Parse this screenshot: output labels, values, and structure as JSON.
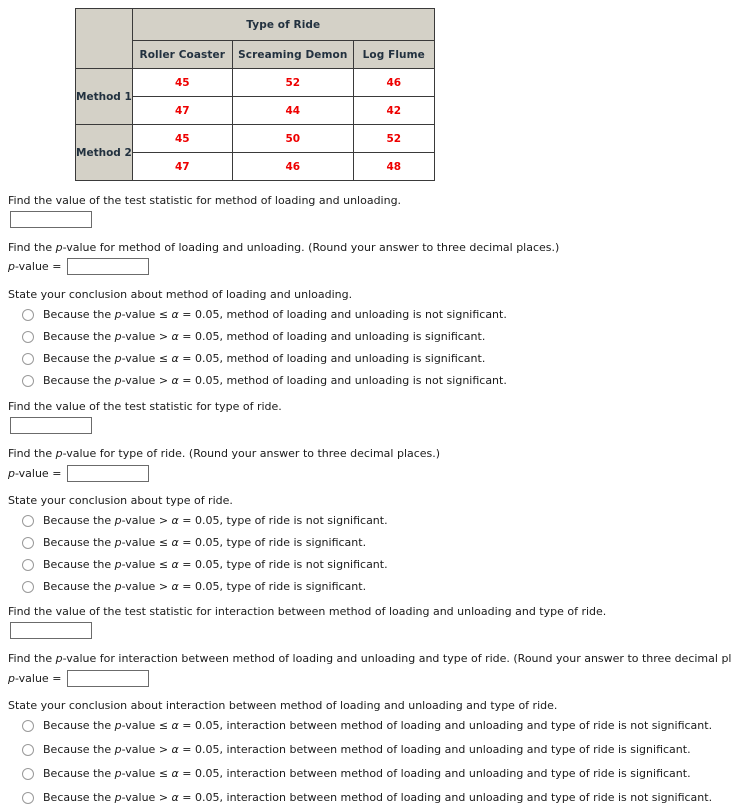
{
  "table": {
    "corner_label": "",
    "group_header": "Type of Ride",
    "columns": [
      "Roller Coaster",
      "Screaming Demon",
      "Log Flume"
    ],
    "row_groups": [
      {
        "label": "Method 1",
        "rows": [
          [
            "45",
            "52",
            "46"
          ],
          [
            "47",
            "44",
            "42"
          ]
        ]
      },
      {
        "label": "Method 2",
        "rows": [
          [
            "45",
            "50",
            "52"
          ],
          [
            "47",
            "46",
            "48"
          ]
        ]
      }
    ],
    "value_color": "#ee0000",
    "header_bg": "#d4d1c7"
  },
  "sections": [
    {
      "statistic_prompt": "Find the value of the test statistic for method of loading and unloading.",
      "statistic_value": "",
      "statistic_placeholder": "",
      "pvalue_prompt_a": "Find the ",
      "pvalue_prompt_b": "-value for method of loading and unloading. (Round your answer to three decimal places.)",
      "pvalue_label_b": "-value =",
      "pvalue_value": "",
      "conclusion_prompt": "State your conclusion about method of loading and unloading.",
      "options": [
        {
          "pre": "Because the ",
          "mid": "-value ≤ ",
          "post": " = 0.05, method of loading and unloading is not significant."
        },
        {
          "pre": "Because the ",
          "mid": "-value > ",
          "post": " = 0.05, method of loading and unloading is significant."
        },
        {
          "pre": "Because the ",
          "mid": "-value ≤ ",
          "post": " = 0.05, method of loading and unloading is significant."
        },
        {
          "pre": "Because the ",
          "mid": "-value > ",
          "post": " = 0.05, method of loading and unloading is not significant."
        }
      ]
    },
    {
      "statistic_prompt": "Find the value of the test statistic for type of ride.",
      "statistic_value": "",
      "statistic_placeholder": "",
      "pvalue_prompt_a": "Find the ",
      "pvalue_prompt_b": "-value for type of ride. (Round your answer to three decimal places.)",
      "pvalue_label_b": "-value =",
      "pvalue_value": "",
      "conclusion_prompt": "State your conclusion about type of ride.",
      "options": [
        {
          "pre": "Because the ",
          "mid": "-value > ",
          "post": " = 0.05, type of ride is not significant."
        },
        {
          "pre": "Because the ",
          "mid": "-value ≤ ",
          "post": " = 0.05, type of ride is significant."
        },
        {
          "pre": "Because the ",
          "mid": "-value ≤ ",
          "post": " = 0.05, type of ride is not significant."
        },
        {
          "pre": "Because the ",
          "mid": "-value > ",
          "post": " = 0.05, type of ride is significant."
        }
      ]
    },
    {
      "statistic_prompt": "Find the value of the test statistic for interaction between method of loading and unloading and type of ride.",
      "statistic_value": "",
      "statistic_placeholder": "",
      "pvalue_prompt_a": "Find the ",
      "pvalue_prompt_b": "-value for interaction between method of loading and unloading and type of ride. (Round your answer to three decimal places.)",
      "pvalue_label_b": "-value =",
      "pvalue_value": "",
      "conclusion_prompt": "State your conclusion about interaction between method of loading and unloading and type of ride.",
      "options": [
        {
          "pre": "Because the ",
          "mid": "-value ≤ ",
          "post": " = 0.05, interaction between method of loading and unloading and type of ride is not significant."
        },
        {
          "pre": "Because the ",
          "mid": "-value > ",
          "post": " = 0.05, interaction between method of loading and unloading and type of ride is significant."
        },
        {
          "pre": "Because the ",
          "mid": "-value ≤ ",
          "post": " = 0.05, interaction between method of loading and unloading and type of ride is significant."
        },
        {
          "pre": "Because the ",
          "mid": "-value > ",
          "post": " = 0.05, interaction between method of loading and unloading and type of ride is not significant."
        }
      ]
    }
  ],
  "symbols": {
    "p": "p",
    "alpha": "α"
  }
}
